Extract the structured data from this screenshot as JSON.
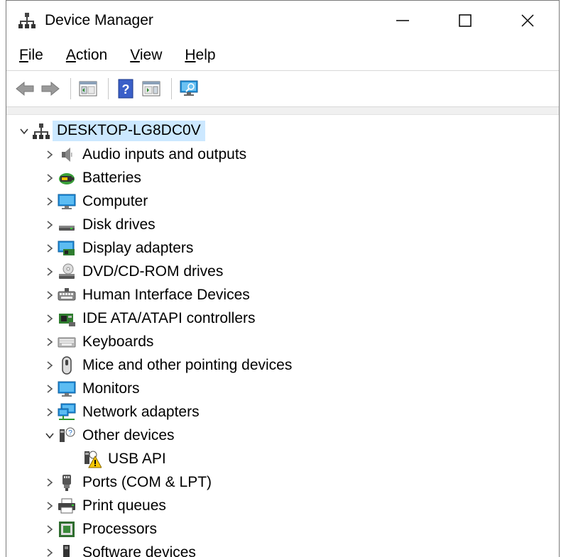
{
  "window": {
    "title": "Device Manager",
    "icon": "device-manager-icon",
    "controls": [
      "minimize-icon",
      "maximize-icon",
      "close-icon"
    ]
  },
  "menu": {
    "file": {
      "accel": "F",
      "rest": "ile"
    },
    "action": {
      "accel": "A",
      "rest": "ction"
    },
    "view": {
      "accel": "V",
      "rest": "iew"
    },
    "help": {
      "accel": "H",
      "rest": "elp"
    }
  },
  "toolbar": [
    "back-arrow-icon",
    "forward-arrow-icon",
    "show-hide-console-tree-icon",
    "help-icon",
    "show-hide-action-pane-icon",
    "scan-hardware-changes-icon"
  ],
  "tree": {
    "root": "DESKTOP-LG8DC0V",
    "categories": [
      {
        "label": "Audio inputs and outputs",
        "icon": "speaker-icon",
        "expanded": false
      },
      {
        "label": "Batteries",
        "icon": "battery-icon",
        "expanded": false
      },
      {
        "label": "Computer",
        "icon": "computer-icon",
        "expanded": false
      },
      {
        "label": "Disk drives",
        "icon": "disk-drive-icon",
        "expanded": false
      },
      {
        "label": "Display adapters",
        "icon": "display-adapter-icon",
        "expanded": false
      },
      {
        "label": "DVD/CD-ROM drives",
        "icon": "dvd-drive-icon",
        "expanded": false
      },
      {
        "label": "Human Interface Devices",
        "icon": "hid-icon",
        "expanded": false
      },
      {
        "label": "IDE ATA/ATAPI controllers",
        "icon": "ide-controller-icon",
        "expanded": false
      },
      {
        "label": "Keyboards",
        "icon": "keyboard-icon",
        "expanded": false
      },
      {
        "label": "Mice and other pointing devices",
        "icon": "mouse-icon",
        "expanded": false
      },
      {
        "label": "Monitors",
        "icon": "monitor-icon",
        "expanded": false
      },
      {
        "label": "Network adapters",
        "icon": "network-adapter-icon",
        "expanded": false
      },
      {
        "label": "Other devices",
        "icon": "unknown-device-icon",
        "expanded": true
      },
      {
        "label": "Ports (COM & LPT)",
        "icon": "port-icon",
        "expanded": false
      },
      {
        "label": "Print queues",
        "icon": "printer-icon",
        "expanded": false
      },
      {
        "label": "Processors",
        "icon": "processor-icon",
        "expanded": false
      },
      {
        "label": "Software devices",
        "icon": "software-device-icon",
        "expanded": false
      }
    ],
    "other_devices_children": [
      {
        "label": "USB API",
        "icon": "warning-device-icon"
      }
    ]
  },
  "colors": {
    "selection": "#cce8ff",
    "accent": "#0078d7",
    "warning": "#f7c600"
  }
}
